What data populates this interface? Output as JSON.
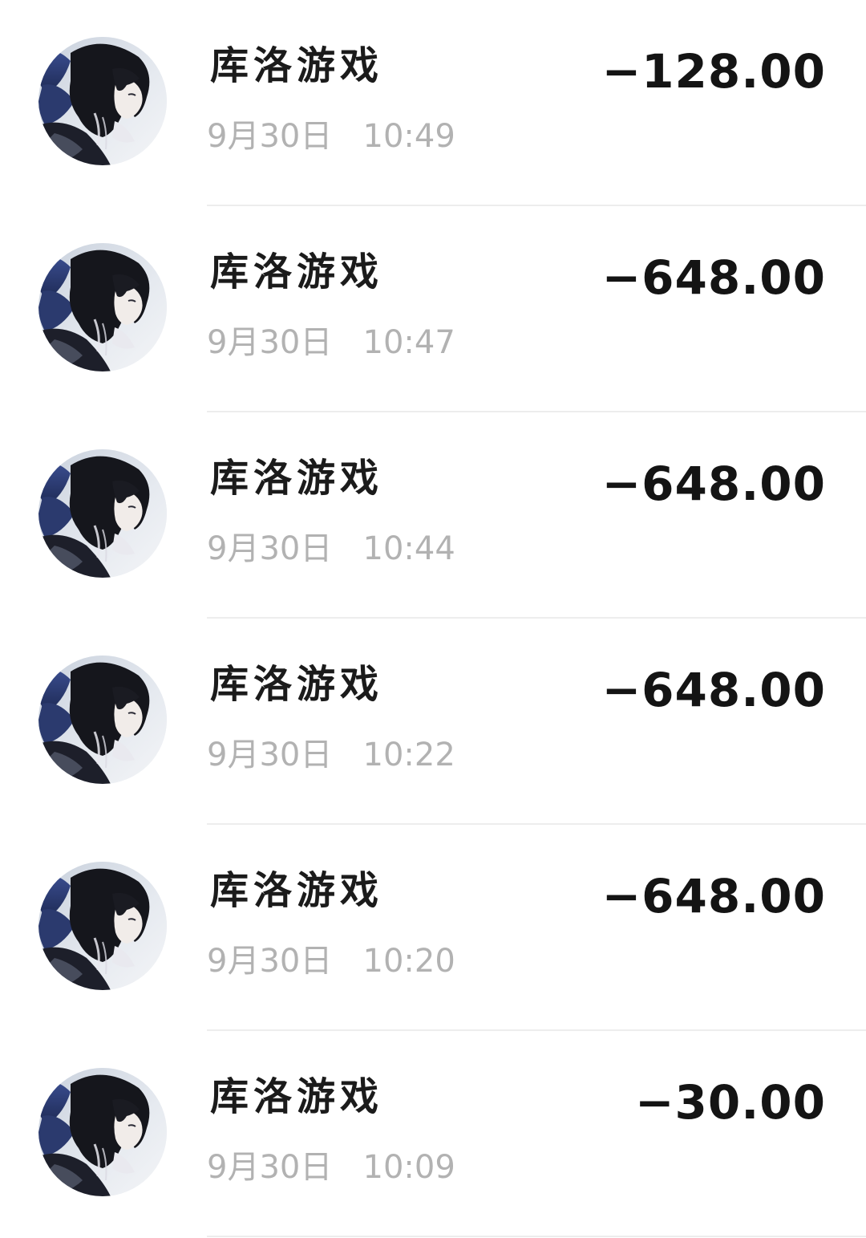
{
  "transactions": [
    {
      "merchant": "库洛游戏",
      "date": "9月30日",
      "time": "10:49",
      "amount": "−128.00",
      "avatar_icon": "anime-character-avatar-icon"
    },
    {
      "merchant": "库洛游戏",
      "date": "9月30日",
      "time": "10:47",
      "amount": "−648.00",
      "avatar_icon": "anime-character-avatar-icon"
    },
    {
      "merchant": "库洛游戏",
      "date": "9月30日",
      "time": "10:44",
      "amount": "−648.00",
      "avatar_icon": "anime-character-avatar-icon"
    },
    {
      "merchant": "库洛游戏",
      "date": "9月30日",
      "time": "10:22",
      "amount": "−648.00",
      "avatar_icon": "anime-character-avatar-icon"
    },
    {
      "merchant": "库洛游戏",
      "date": "9月30日",
      "time": "10:20",
      "amount": "−648.00",
      "avatar_icon": "anime-character-avatar-icon"
    },
    {
      "merchant": "库洛游戏",
      "date": "9月30日",
      "time": "10:09",
      "amount": "−30.00",
      "avatar_icon": "anime-character-avatar-icon"
    }
  ],
  "colors": {
    "amount": "#141414",
    "merchant": "#1b1b1b",
    "datetime": "#b2b2b2",
    "divider": "#ededed",
    "background": "#ffffff"
  }
}
